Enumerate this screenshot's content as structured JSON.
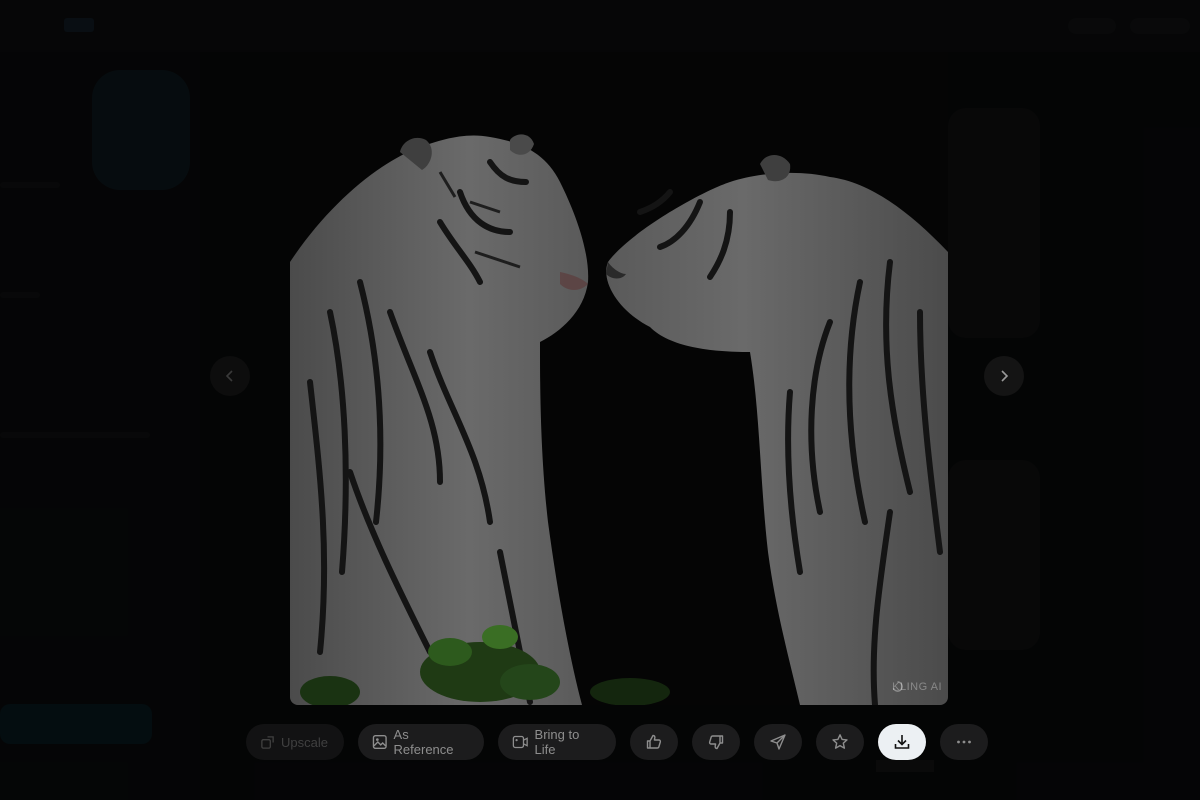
{
  "toolbar": {
    "upscale_label": "Upscale",
    "as_reference_label": "As Reference",
    "bring_to_life_label": "Bring to Life"
  },
  "watermark": {
    "text": "KLING AI"
  },
  "icons": {
    "upscale": "upscale-icon",
    "as_reference": "image-icon",
    "bring_to_life": "video-icon",
    "like": "thumbs-up-icon",
    "dislike": "thumbs-down-icon",
    "share": "send-icon",
    "favorite": "star-icon",
    "download": "download-icon",
    "more": "more-icon",
    "prev": "chevron-left-icon",
    "next": "chevron-right-icon"
  },
  "colors": {
    "overlay": "#000000",
    "active_button": "#ecf0f3",
    "button": "#1c1c1d"
  }
}
